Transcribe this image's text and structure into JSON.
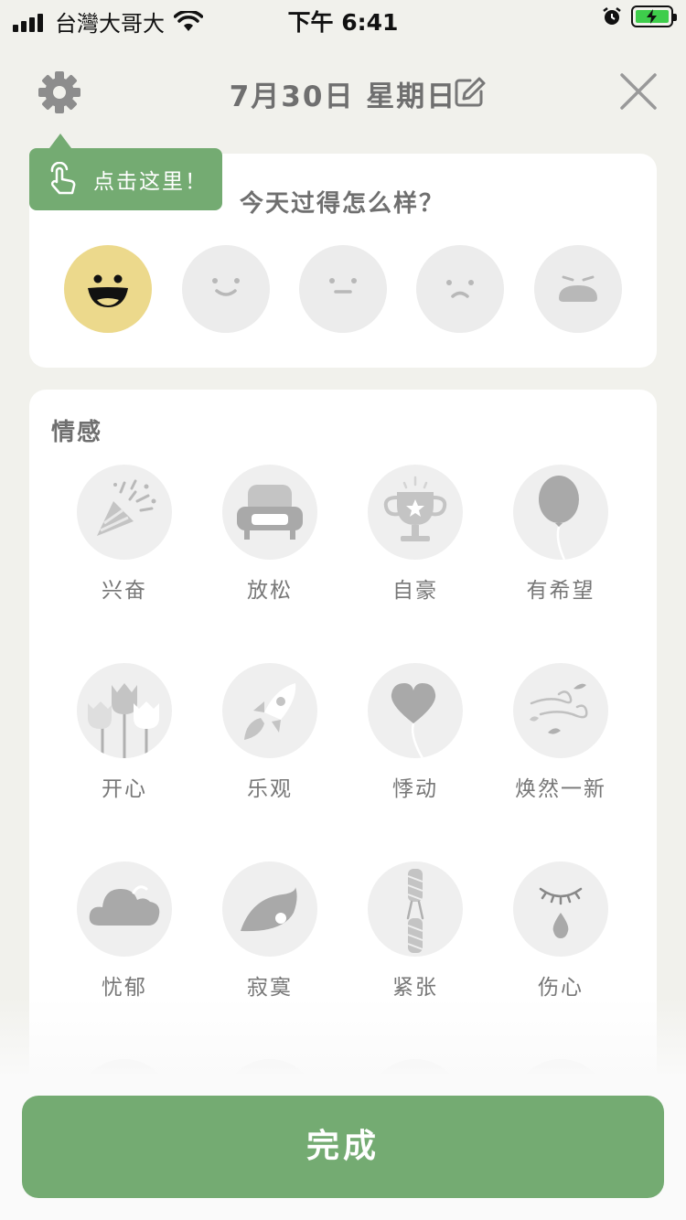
{
  "status_bar": {
    "carrier": "台灣大哥大",
    "time": "下午 6:41"
  },
  "header": {
    "date": "7月30日 星期日"
  },
  "tooltip": {
    "text": "点击这里！"
  },
  "mood": {
    "question": "今天过得怎么样？",
    "options": [
      "great-face-icon",
      "good-face-icon",
      "neutral-face-icon",
      "sad-face-icon",
      "awful-face-icon"
    ],
    "selected_index": 0
  },
  "emotions": {
    "title": "情感",
    "items": [
      {
        "label": "兴奋",
        "icon": "party-popper-icon"
      },
      {
        "label": "放松",
        "icon": "armchair-icon"
      },
      {
        "label": "自豪",
        "icon": "trophy-icon"
      },
      {
        "label": "有希望",
        "icon": "balloon-icon"
      },
      {
        "label": "开心",
        "icon": "tulips-icon"
      },
      {
        "label": "乐观",
        "icon": "rocket-icon"
      },
      {
        "label": "悸动",
        "icon": "heart-balloon-icon"
      },
      {
        "label": "焕然一新",
        "icon": "wind-leaves-icon"
      },
      {
        "label": "忧郁",
        "icon": "cloud-icon"
      },
      {
        "label": "寂寞",
        "icon": "leaf-icon"
      },
      {
        "label": "紧张",
        "icon": "rope-icon"
      },
      {
        "label": "伤心",
        "icon": "teardrop-eye-icon"
      }
    ]
  },
  "footer": {
    "done_label": "完成"
  },
  "colors": {
    "accent_green": "#74ab72",
    "selected_mood": "#ecd98c",
    "background": "#f1f1ec",
    "icon_gray": "#a9a9a9"
  }
}
